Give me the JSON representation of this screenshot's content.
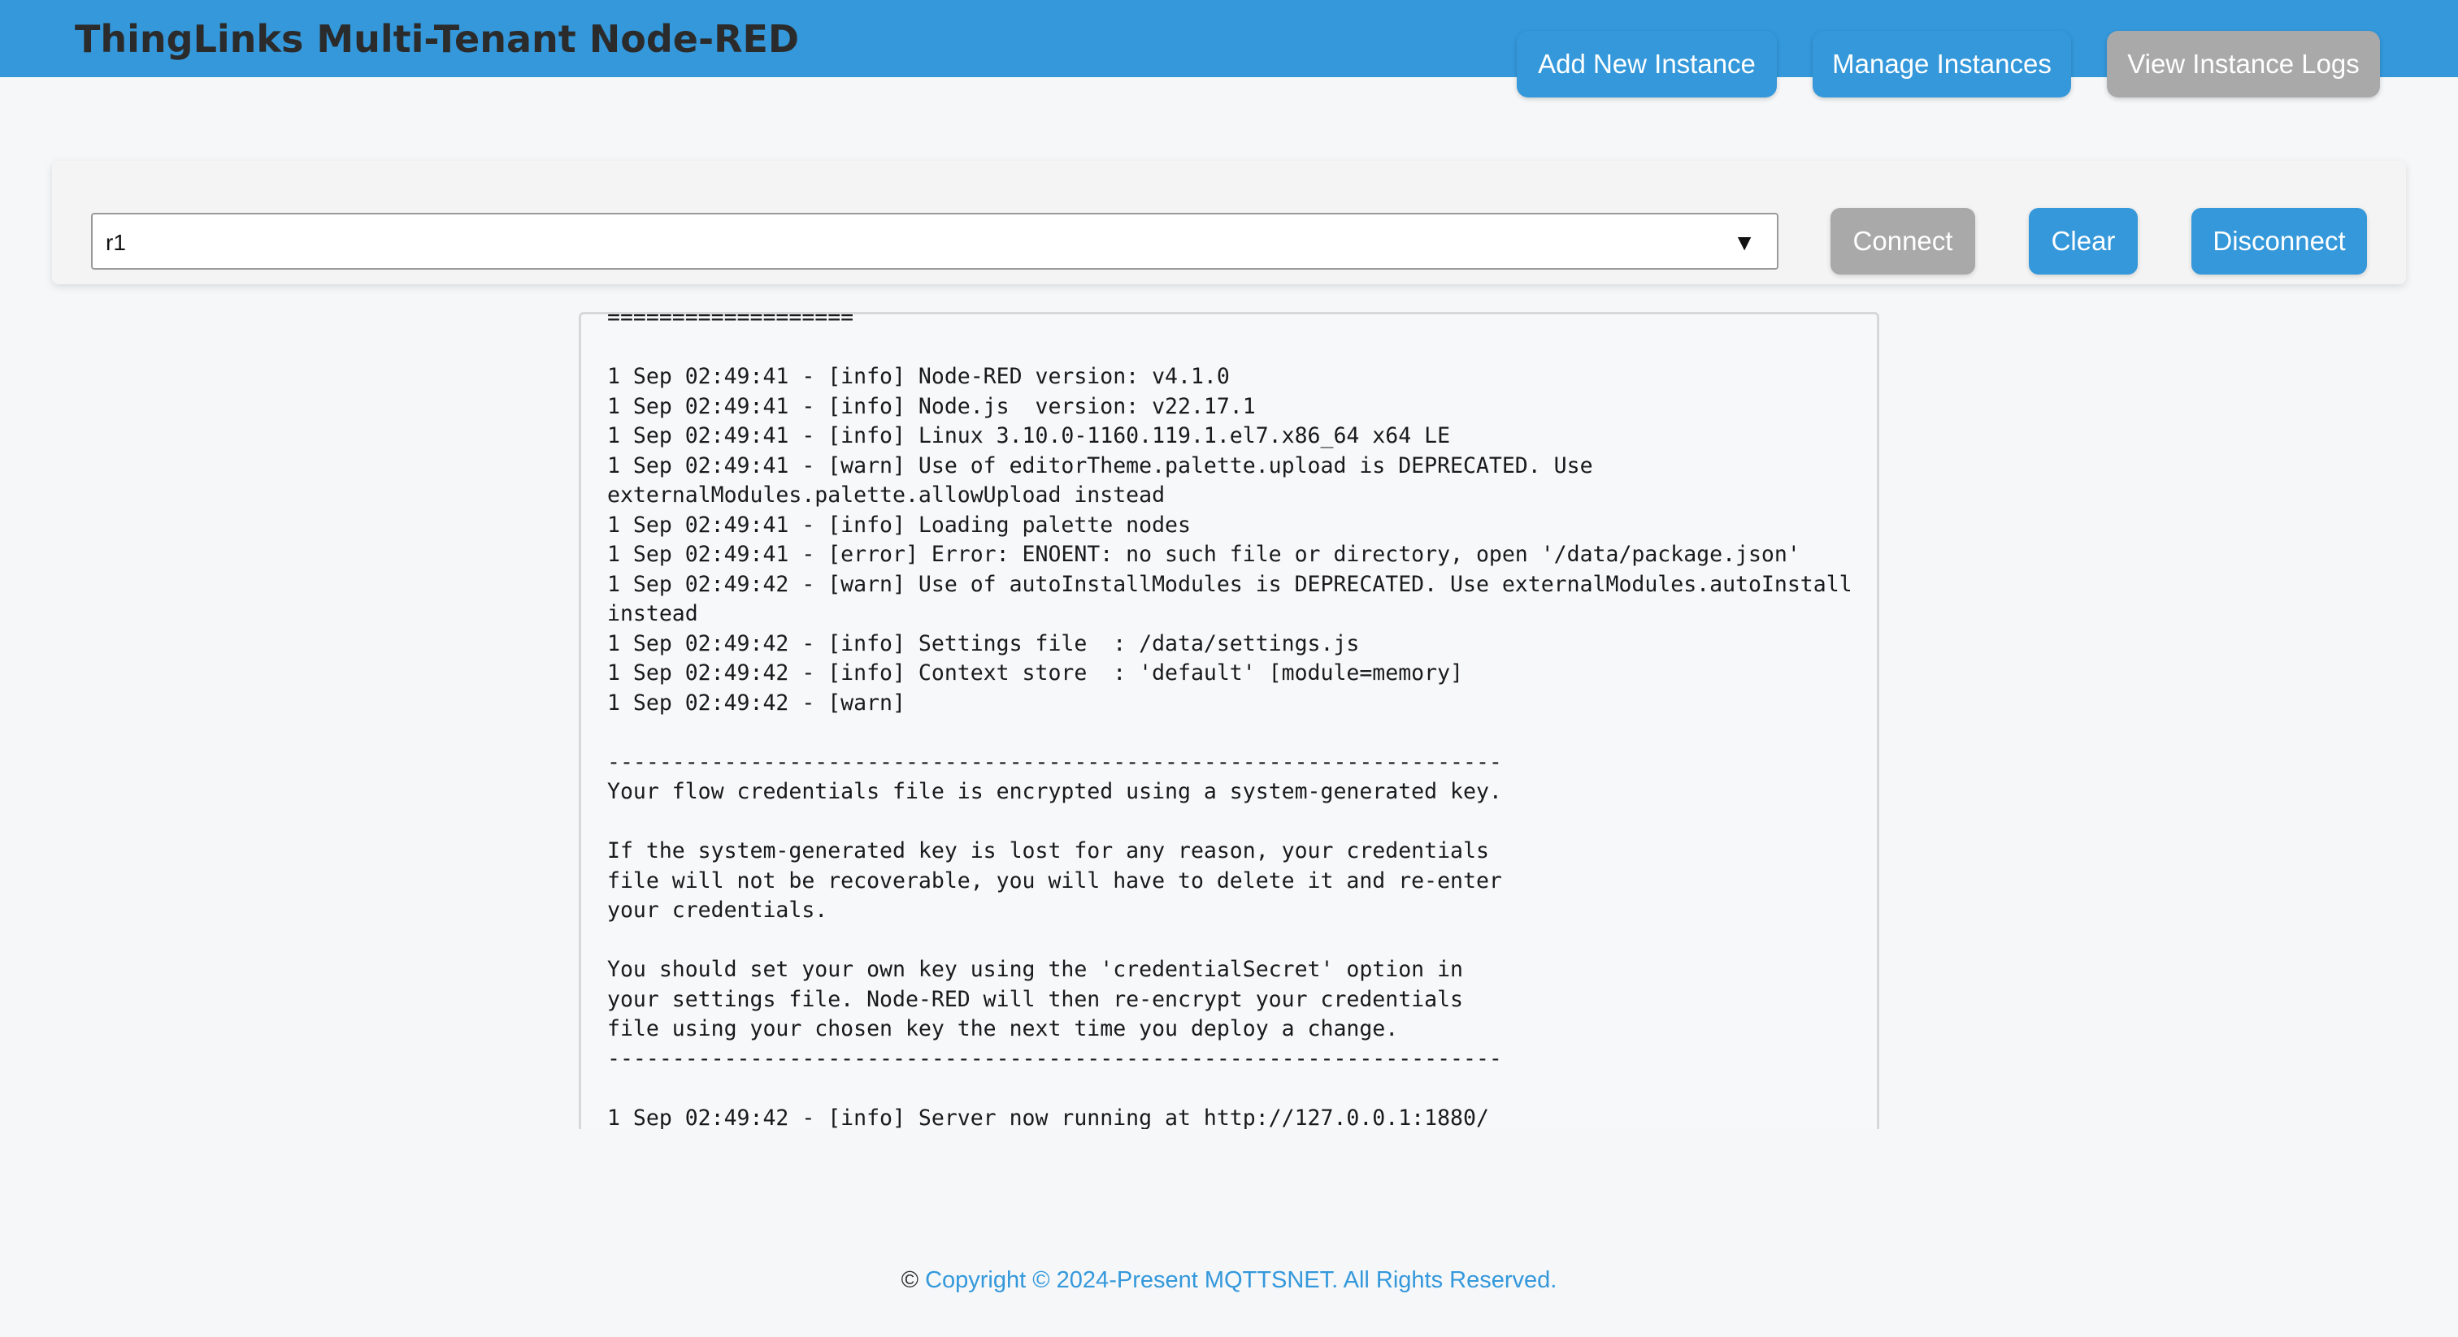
{
  "header": {
    "title": "ThingLinks Multi-Tenant Node-RED",
    "nav": {
      "add_label": "Add New Instance",
      "manage_label": "Manage Instances",
      "logs_label": "View Instance Logs"
    }
  },
  "controls": {
    "instance_select": {
      "value": "r1",
      "arrow": "▼"
    },
    "connect_label": "Connect",
    "clear_label": "Clear",
    "disconnect_label": "Disconnect"
  },
  "log": {
    "text": "===================\n\n1 Sep 02:49:41 - [info] Node-RED version: v4.1.0\n1 Sep 02:49:41 - [info] Node.js  version: v22.17.1\n1 Sep 02:49:41 - [info] Linux 3.10.0-1160.119.1.el7.x86_64 x64 LE\n1 Sep 02:49:41 - [warn] Use of editorTheme.palette.upload is DEPRECATED. Use\nexternalModules.palette.allowUpload instead\n1 Sep 02:49:41 - [info] Loading palette nodes\n1 Sep 02:49:41 - [error] Error: ENOENT: no such file or directory, open '/data/package.json'\n1 Sep 02:49:42 - [warn] Use of autoInstallModules is DEPRECATED. Use externalModules.autoInstall\ninstead\n1 Sep 02:49:42 - [info] Settings file  : /data/settings.js\n1 Sep 02:49:42 - [info] Context store  : 'default' [module=memory]\n1 Sep 02:49:42 - [warn]\n\n---------------------------------------------------------------------\nYour flow credentials file is encrypted using a system-generated key.\n\nIf the system-generated key is lost for any reason, your credentials\nfile will not be recoverable, you will have to delete it and re-enter\nyour credentials.\n\nYou should set your own key using the 'credentialSecret' option in\nyour settings file. Node-RED will then re-encrypt your credentials\nfile using your chosen key the next time you deploy a change.\n---------------------------------------------------------------------\n\n1 Sep 02:49:42 - [info] Server now running at http://127.0.0.1:1880/"
  },
  "footer": {
    "symbol": "©",
    "link_text": "Copyright © 2024-Present MQTTSNET. All Rights Reserved."
  },
  "colors": {
    "accent": "#3498db",
    "disabled": "#a9a9a9",
    "background": "#f5f7f9"
  }
}
